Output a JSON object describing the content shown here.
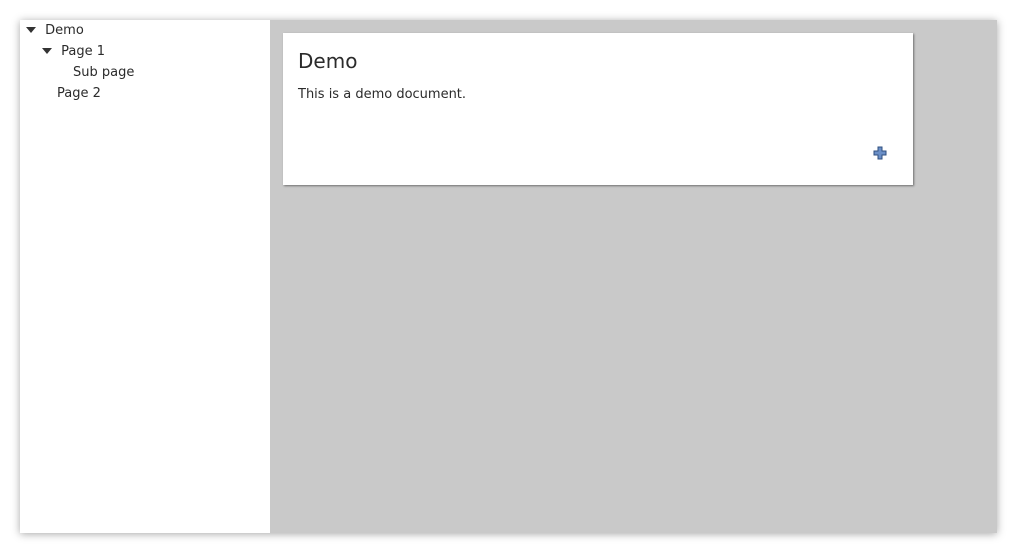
{
  "tree": {
    "items": [
      {
        "label": "Demo",
        "expanded": true,
        "level": 0
      },
      {
        "label": "Page 1",
        "expanded": true,
        "level": 1
      },
      {
        "label": "Sub page",
        "expanded": false,
        "level": 2
      },
      {
        "label": "Page 2",
        "expanded": false,
        "level": 1
      }
    ]
  },
  "document": {
    "title": "Demo",
    "body": "This is a demo document."
  },
  "icons": {
    "expand": "triangle-down-icon",
    "add": "plus-icon"
  },
  "colors": {
    "canvas_background": "#c9c9c9",
    "plus_fill": "#6b8fc7",
    "plus_stroke": "#2f4f7f"
  }
}
